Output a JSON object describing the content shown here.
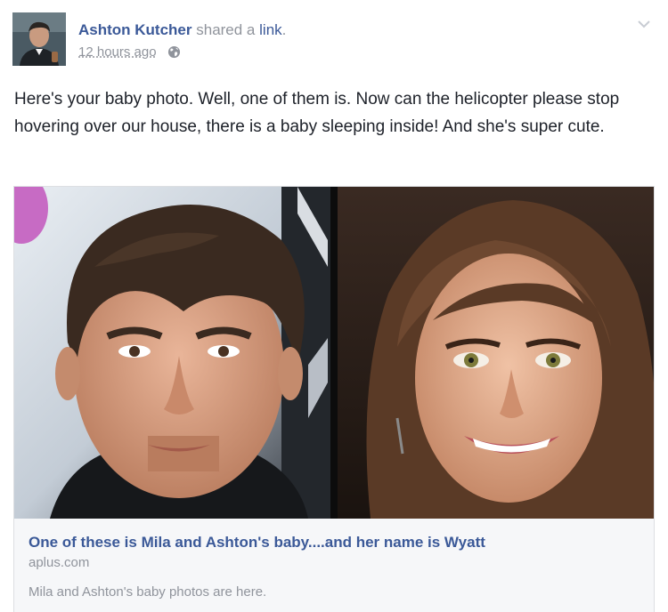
{
  "post": {
    "author": "Ashton Kutcher",
    "action_prefix": "shared a",
    "action_link": "link",
    "action_suffix": ".",
    "timestamp": "12 hours ago",
    "privacy_icon": "globe-icon",
    "menu_icon": "chevron-down-icon",
    "message": "Here's your baby photo. Well, one of them is. Now can the helicopter please stop hovering over our house, there is a baby sleeping inside! And she's super cute."
  },
  "link_card": {
    "title": "One of these is Mila and Ashton's baby....and her name is Wyatt",
    "domain": "aplus.com",
    "description": "Mila and Ashton's baby photos are here."
  },
  "colors": {
    "link_blue": "#3b5998",
    "meta_gray": "#90949c",
    "text": "#1d2129",
    "card_bg": "#f6f7f9"
  }
}
